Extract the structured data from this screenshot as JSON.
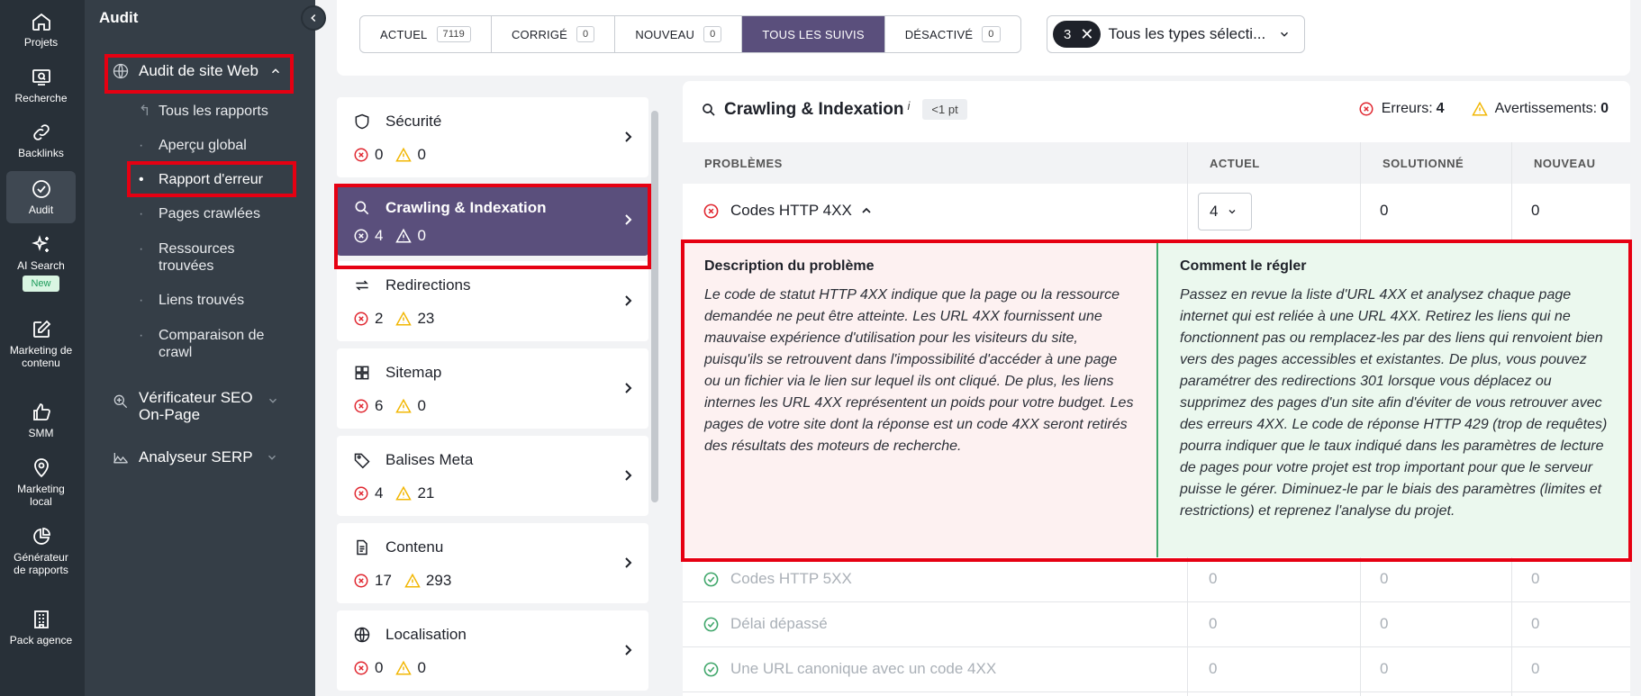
{
  "rail": {
    "items": [
      {
        "label": "Projets",
        "icon": "home-icon"
      },
      {
        "label": "Recherche",
        "icon": "search-screen-icon"
      },
      {
        "label": "Backlinks",
        "icon": "link-icon"
      },
      {
        "label": "Audit",
        "icon": "check-circle-icon"
      },
      {
        "label": "AI Search",
        "icon": "sparkle-icon",
        "badge": "New"
      },
      {
        "label": "Marketing de contenu",
        "icon": "edit-icon"
      },
      {
        "label": "SMM",
        "icon": "thumbs-up-icon"
      },
      {
        "label": "Marketing local",
        "icon": "location-pin-icon"
      },
      {
        "label": "Générateur de rapports",
        "icon": "pie-chart-icon"
      },
      {
        "label": "Pack agence",
        "icon": "building-icon"
      }
    ]
  },
  "nav": {
    "title": "Audit",
    "site_audit": "Audit de site Web",
    "sub_items": [
      "Tous les rapports",
      "Aperçu global",
      "Rapport d'erreur",
      "Pages crawlées",
      "Ressources trouvées",
      "Liens trouvés",
      "Comparaison de crawl"
    ],
    "onpage": "Vérificateur SEO On-Page",
    "serp": "Analyseur SERP"
  },
  "filters": {
    "tabs": [
      {
        "label": "ACTUEL",
        "count": "7119"
      },
      {
        "label": "CORRIGÉ",
        "count": "0"
      },
      {
        "label": "NOUVEAU",
        "count": "0"
      },
      {
        "label": "TOUS LES SUIVIS",
        "count": ""
      },
      {
        "label": "DÉSACTIVÉ",
        "count": "0"
      }
    ],
    "types_count": "3",
    "types_label": "Tous les types sélecti..."
  },
  "categories": [
    {
      "name": "Sécurité",
      "icon": "shield-icon",
      "errors": "0",
      "warnings": "0"
    },
    {
      "name": "Crawling & Indexation",
      "icon": "search-icon",
      "errors": "4",
      "warnings": "0"
    },
    {
      "name": "Redirections",
      "icon": "redirect-icon",
      "errors": "2",
      "warnings": "23"
    },
    {
      "name": "Sitemap",
      "icon": "grid-icon",
      "errors": "6",
      "warnings": "0"
    },
    {
      "name": "Balises Meta",
      "icon": "tag-icon",
      "errors": "4",
      "warnings": "21"
    },
    {
      "name": "Contenu",
      "icon": "document-icon",
      "errors": "17",
      "warnings": "293"
    },
    {
      "name": "Localisation",
      "icon": "globe-icon",
      "errors": "0",
      "warnings": "0"
    }
  ],
  "main": {
    "title": "Crawling & Indexation",
    "info": "i",
    "points": "<1 pt",
    "errors_label": "Erreurs:",
    "errors_value": "4",
    "warnings_label": "Avertissements:",
    "warnings_value": "0",
    "columns": [
      "PROBLÈMES",
      "ACTUEL",
      "SOLUTIONNÉ",
      "NOUVEAU"
    ],
    "expanded": {
      "name": "Codes HTTP 4XX",
      "current": "4",
      "solved": "0",
      "new": "0",
      "desc_title": "Description du problème",
      "desc_text": "Le code de statut HTTP 4XX indique que la page ou la ressource demandée ne peut être atteinte. Les URL 4XX fournissent une mauvaise expérience d'utilisation pour les visiteurs du site, puisqu'ils se retrouvent dans l'impossibilité d'accéder à une page ou un fichier via le lien sur lequel ils ont cliqué. De plus, les liens internes les URL 4XX représentent un poids pour votre budget. Les pages de votre site dont la réponse est un code 4XX seront retirés des résultats des moteurs de recherche.",
      "fix_title": "Comment le régler",
      "fix_text": "Passez en revue la liste d'URL 4XX et analysez chaque page internet qui est reliée à une URL 4XX. Retirez les liens qui ne fonctionnent pas ou remplacez-les par des liens qui renvoient bien vers des pages accessibles et existantes. De plus, vous pouvez paramétrer des redirections 301 lorsque vous déplacez ou supprimez des pages d'un site afin d'éviter de vous retrouver avec des erreurs 4XX. Le code de réponse HTTP 429 (trop de requêtes) pourra indiquer que le taux indiqué dans les paramètres de lecture de pages pour votre projet est trop important pour que le serveur puisse le gérer. Diminuez-le par le biais des paramètres (limites et restrictions) et reprenez l'analyse du projet."
    },
    "rows": [
      {
        "name": "Codes HTTP 5XX",
        "current": "0",
        "solved": "0",
        "new": "0"
      },
      {
        "name": "Délai dépassé",
        "current": "0",
        "solved": "0",
        "new": "0"
      },
      {
        "name": "Une URL canonique avec un code 4XX",
        "current": "0",
        "solved": "0",
        "new": "0"
      }
    ]
  },
  "colors": {
    "accent": "#5a4f7c",
    "error": "#e0262f",
    "warning": "#f2b705",
    "ok": "#3fa66a",
    "highlight": "#e60012"
  }
}
